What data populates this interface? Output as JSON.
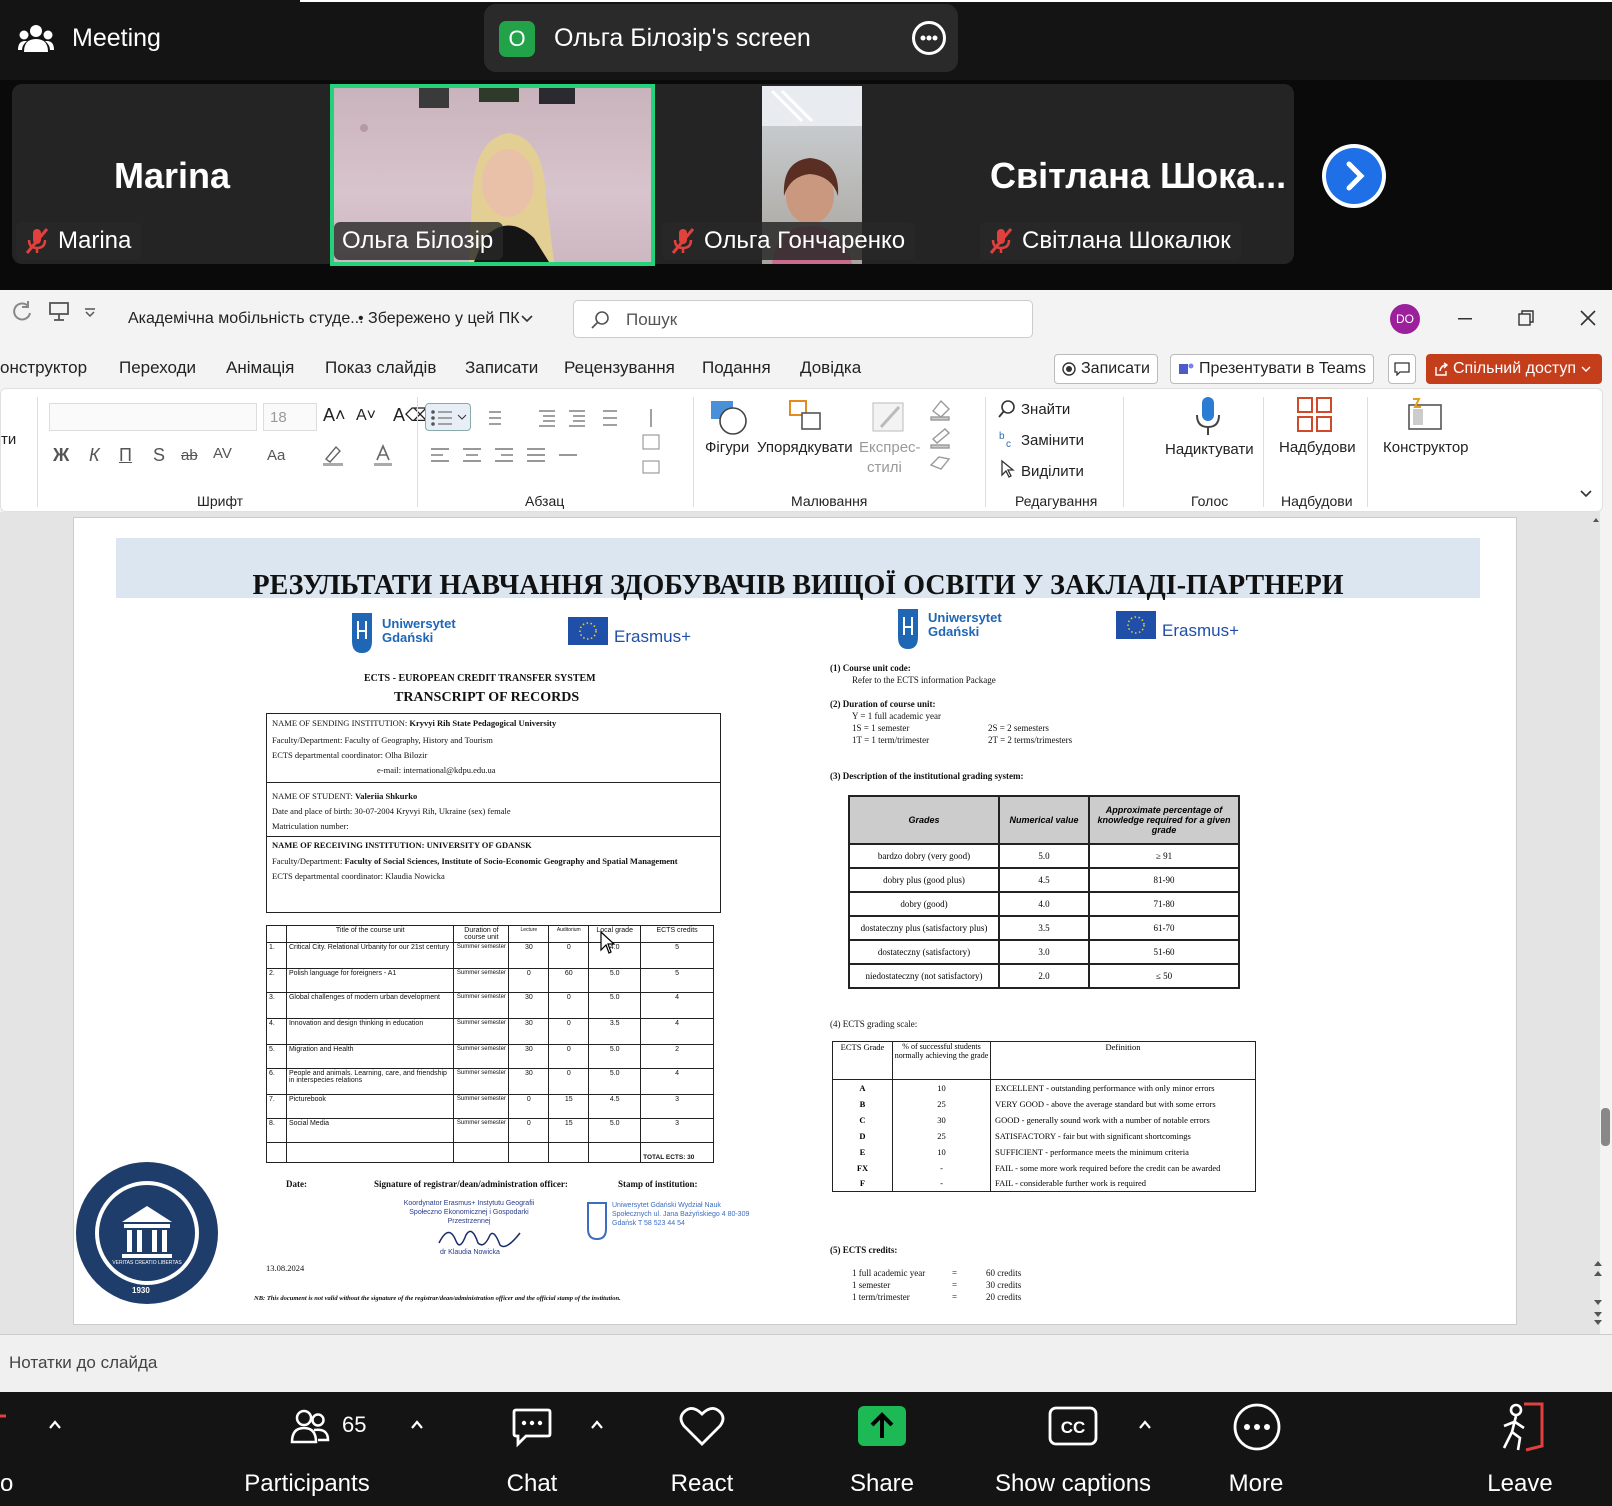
{
  "meeting": {
    "title": "Meeting",
    "share_initial": "О",
    "share_label": "Ольга Білозір's screen"
  },
  "participants": [
    {
      "big_name": "Marina",
      "label": "Marina",
      "muted": true
    },
    {
      "label": "Ольга Білозір",
      "muted": false,
      "speaking": true
    },
    {
      "label": "Ольга Гончаренко",
      "muted": true
    },
    {
      "big_name": "Світлана  Шока...",
      "label": "Світлана Шокалюк",
      "muted": true
    }
  ],
  "ppt": {
    "doc_title": "Академічна мобільність студе...",
    "save_status": "• Збережено у цей ПК",
    "search_placeholder": "Пошук",
    "avatar": "DO",
    "menu": [
      "онструктор",
      "Переходи",
      "Анімація",
      "Показ слайдів",
      "Записати",
      "Рецензування",
      "Подання",
      "Довідка"
    ],
    "record_btn": "Записати",
    "present_btn": "Презентувати в Teams",
    "share_btn": "Спільний доступ",
    "ribbon": {
      "font_size": "18",
      "group_font": "Шрифт",
      "group_paragraph": "Абзац",
      "group_drawing": "Малювання",
      "group_editing": "Редагування",
      "group_voice": "Голос",
      "group_addins": "Надбудови",
      "shapes": "Фігури",
      "arrange": "Упорядкувати",
      "express_styles_1": "Експрес-",
      "express_styles_2": "стилі",
      "find": "Знайти",
      "replace": "Замінити",
      "select": "Виділити",
      "dictate": "Надиктувати",
      "addins": "Надбудови",
      "designer": "Конструктор",
      "left_cut_1": "ти",
      "font_btns": [
        "Ж",
        "К",
        "П",
        "S",
        "ab",
        "AV",
        "Aa"
      ]
    },
    "notes_placeholder": "Нотатки до слайда"
  },
  "slide": {
    "title": "РЕЗУЛЬТАТИ НАВЧАННЯ ЗДОБУВАЧІВ ВИЩОЇ ОСВІТИ У ЗАКЛАДІ-ПАРТНЕРИ",
    "ug_line1": "Uniwersytet",
    "ug_line2": "Gdański",
    "erasmus": "Erasmus+",
    "ects_header": "ECTS - EUROPEAN CREDIT TRANSFER SYSTEM",
    "transcript_header": "TRANSCRIPT OF RECORDS",
    "sending_label": "NAME OF SENDING INSTITUTION:",
    "sending_value": "Kryvyi Rih State Pedagogical University",
    "faculty_line": "Faculty/Department: Faculty of Geography, History and Tourism",
    "coord_line": "ECTS departmental coordinator: Olha Bilozir",
    "email_line": "e-mail: international@kdpu.edu.ua",
    "student_label": "NAME OF STUDENT:",
    "student_value": "Valeriia Shkurko",
    "birth_line": "Date and place of birth: 30-07-2004 Kryvyi Rih, Ukraine     (sex) female",
    "matric_line": "Matriculation number:",
    "receiving_label": "NAME OF RECEIVING INSTITUTION:   UNIVERSITY OF GDANSK",
    "recv_faculty_label": "Faculty/Department:",
    "recv_faculty_value": "Faculty of Social Sciences, Institute of Socio-Economic Geography and Spatial Management",
    "recv_coord_line": "ECTS departmental coordinator: Klaudia Nowicka",
    "course_headers": [
      "Title of the course unit",
      "Duration of course unit",
      "Lecture",
      "Auditorium",
      "Local grade",
      "ECTS credits"
    ],
    "courses": [
      {
        "n": "1.",
        "title": "Critical City. Relational Urbanity for our 21st century",
        "dur": "Summer semester",
        "lec": "30",
        "aud": "0",
        "grade": "4.0",
        "ects": "5"
      },
      {
        "n": "2.",
        "title": "Polish language for foreigners - A1",
        "dur": "Summer semester",
        "lec": "0",
        "aud": "60",
        "grade": "5.0",
        "ects": "5"
      },
      {
        "n": "3.",
        "title": "Global challenges of modern urban development",
        "dur": "Summer semester",
        "lec": "30",
        "aud": "0",
        "grade": "5.0",
        "ects": "4"
      },
      {
        "n": "4.",
        "title": "Innovation and design thinking in education",
        "dur": "Summer semester",
        "lec": "30",
        "aud": "0",
        "grade": "3.5",
        "ects": "4"
      },
      {
        "n": "5.",
        "title": "Migration and Health",
        "dur": "Summer semester",
        "lec": "30",
        "aud": "0",
        "grade": "5.0",
        "ects": "2"
      },
      {
        "n": "6.",
        "title": "People and animals. Learning, care, and friendship in interspecies relations",
        "dur": "Summer semester",
        "lec": "30",
        "aud": "0",
        "grade": "5.0",
        "ects": "4"
      },
      {
        "n": "7.",
        "title": "Picturebook",
        "dur": "Summer semester",
        "lec": "0",
        "aud": "15",
        "grade": "4.5",
        "ects": "3"
      },
      {
        "n": "8.",
        "title": "Social Media",
        "dur": "Summer semester",
        "lec": "0",
        "aud": "15",
        "grade": "5.0",
        "ects": "3"
      }
    ],
    "total_ects": "TOTAL ECTS: 30",
    "sig_date": "Date:",
    "sig_signature": "Signature of registrar/dean/administration officer:",
    "sig_stamp": "Stamp of institution:",
    "coordinator_stamp": "Koordynator Erasmus+ Instytutu Geografii Społeczno Ekonomicznej i Gospodarki Przestrzennej",
    "signer": "dr Klaudia Nowicka",
    "inst_stamp": "Uniwersytet Gdański Wydział Nauk Społecznych ul. Jana Bażyńskiego 4 80-309 Gdańsk T 58 523 44 54",
    "doc_date": "13.08.2024",
    "nb_note": "NB: This document is not valid without the signature of the registrar/dean/administration officer and the official stamp of the institution.",
    "seal_text": "КРИВОРІЗЬКИЙ ДЕРЖАВНИЙ ПЕДАГОГІЧНИЙ УНІВЕРСИТЕТ",
    "seal_year": "1930",
    "seal_motto": "VERITAS CREATIO LIBERTAS",
    "note1_title": "(1)   Course unit code:",
    "note1_text": "Refer to the ECTS information Package",
    "note2_title": "(2)   Duration of course unit:",
    "note2_lines": [
      "Y = 1 full academic year",
      "1S = 1 semester",
      "2S = 2 semesters",
      "1T = 1 term/trimester",
      "2T = 2 terms/trimesters"
    ],
    "note3_title": "(3)   Description of the institutional grading system:",
    "grade_headers": [
      "Grades",
      "Numerical value",
      "Approximate percentage of knowledge required for a given grade"
    ],
    "grades": [
      [
        "bardzo dobry (very good)",
        "5.0",
        "≥ 91"
      ],
      [
        "dobry plus (good plus)",
        "4.5",
        "81-90"
      ],
      [
        "dobry (good)",
        "4.0",
        "71-80"
      ],
      [
        "dostateczny plus (satisfactory plus)",
        "3.5",
        "61-70"
      ],
      [
        "dostateczny (satisfactory)",
        "3.0",
        "51-60"
      ],
      [
        "niedostateczny (not satisfactory)",
        "2.0",
        "≤ 50"
      ]
    ],
    "note4_title": "(4)   ECTS grading scale:",
    "ects_headers": [
      "ECTS Grade",
      "% of successful students normally achieving the grade",
      "Definition"
    ],
    "ects_scale": [
      [
        "A",
        "10",
        "EXCELLENT - outstanding performance with only minor errors"
      ],
      [
        "B",
        "25",
        "VERY GOOD - above the average standard but with some errors"
      ],
      [
        "C",
        "30",
        "GOOD - generally sound work with a number of notable errors"
      ],
      [
        "D",
        "25",
        "SATISFACTORY - fair but with significant shortcomings"
      ],
      [
        "E",
        "10",
        "SUFFICIENT - performance meets the minimum criteria"
      ],
      [
        "FX",
        "-",
        "FAIL - some more work required before the credit can be awarded"
      ],
      [
        "F",
        "-",
        "FAIL - considerable further work is required"
      ]
    ],
    "note5_title": "(5)   ECTS credits:",
    "credits": [
      [
        "1 full academic year",
        "=",
        "60 credits"
      ],
      [
        "1 semester",
        "=",
        "30 credits"
      ],
      [
        "1 term/trimester",
        "=",
        "20 credits"
      ]
    ]
  },
  "toolbar": {
    "left_cut": "o",
    "participants_label": "Participants",
    "participants_count": "65",
    "chat_label": "Chat",
    "react_label": "React",
    "share_label": "Share",
    "captions_label": "Show captions",
    "more_label": "More",
    "leave_label": "Leave"
  },
  "colors": {
    "speaker_border": "#23d27b",
    "share_green": "#22a34a",
    "ppt_share_btn": "#c43e1c",
    "next_btn": "#1f6fe6",
    "muted_red": "#e0413c"
  }
}
